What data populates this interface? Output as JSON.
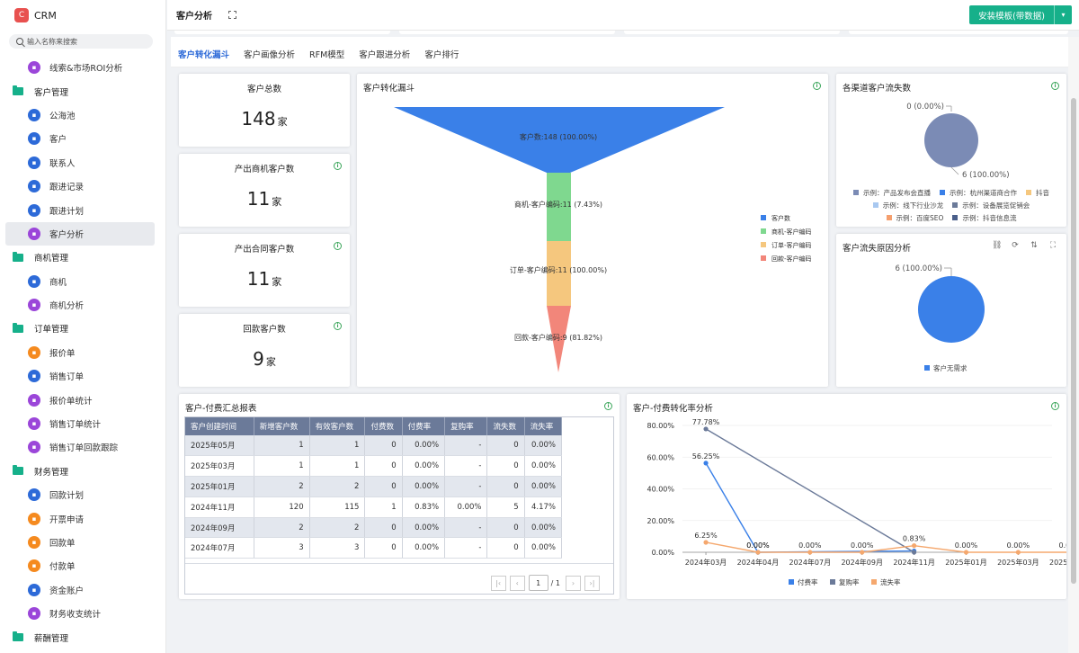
{
  "app": {
    "logo_letter": "C",
    "name": "CRM",
    "search_placeholder": "输入名称来搜索"
  },
  "nav": [
    {
      "type": "item",
      "label": "线索&市场ROI分析",
      "icon": "chart-board-icon",
      "color": "purple"
    },
    {
      "type": "group",
      "label": "客户管理"
    },
    {
      "type": "item",
      "label": "公海池",
      "icon": "user-pool-icon",
      "color": "blue"
    },
    {
      "type": "item",
      "label": "客户",
      "icon": "customer-icon",
      "color": "blue"
    },
    {
      "type": "item",
      "label": "联系人",
      "icon": "contact-icon",
      "color": "blue"
    },
    {
      "type": "item",
      "label": "跟进记录",
      "icon": "record-icon",
      "color": "blue"
    },
    {
      "type": "item",
      "label": "跟进计划",
      "icon": "plan-icon",
      "color": "blue"
    },
    {
      "type": "item",
      "label": "客户分析",
      "icon": "chart-board-icon",
      "color": "purple",
      "active": true
    },
    {
      "type": "group",
      "label": "商机管理"
    },
    {
      "type": "item",
      "label": "商机",
      "icon": "opportunity-icon",
      "color": "blue"
    },
    {
      "type": "item",
      "label": "商机分析",
      "icon": "chart-board-icon",
      "color": "purple"
    },
    {
      "type": "group",
      "label": "订单管理"
    },
    {
      "type": "item",
      "label": "报价单",
      "icon": "send-icon",
      "color": "orange"
    },
    {
      "type": "item",
      "label": "销售订单",
      "icon": "order-icon",
      "color": "blue"
    },
    {
      "type": "item",
      "label": "报价单统计",
      "icon": "chart-board-icon",
      "color": "purple"
    },
    {
      "type": "item",
      "label": "销售订单统计",
      "icon": "chart-board-icon",
      "color": "purple"
    },
    {
      "type": "item",
      "label": "销售订单回款跟踪",
      "icon": "chart-board-icon",
      "color": "purple"
    },
    {
      "type": "group",
      "label": "财务管理"
    },
    {
      "type": "item",
      "label": "回款计划",
      "icon": "plan-icon",
      "color": "blue"
    },
    {
      "type": "item",
      "label": "开票申请",
      "icon": "invoice-icon",
      "color": "orange"
    },
    {
      "type": "item",
      "label": "回款单",
      "icon": "receipt-icon",
      "color": "orange"
    },
    {
      "type": "item",
      "label": "付款单",
      "icon": "payment-icon",
      "color": "orange"
    },
    {
      "type": "item",
      "label": "资金账户",
      "icon": "account-icon",
      "color": "blue"
    },
    {
      "type": "item",
      "label": "财务收支统计",
      "icon": "chart-board-icon",
      "color": "purple"
    },
    {
      "type": "group",
      "label": "薪酬管理"
    }
  ],
  "topbar": {
    "title": "客户分析",
    "install_label": "安装模板(带数据)"
  },
  "tabs": [
    "客户转化漏斗",
    "客户画像分析",
    "RFM模型",
    "客户跟进分析",
    "客户排行"
  ],
  "stats": [
    {
      "label": "客户总数",
      "value": "148",
      "unit": "家",
      "info": false
    },
    {
      "label": "产出商机客户数",
      "value": "11",
      "unit": "家",
      "info": true
    },
    {
      "label": "产出合同客户数",
      "value": "11",
      "unit": "家",
      "info": true
    },
    {
      "label": "回款客户数",
      "value": "9",
      "unit": "家",
      "info": true
    }
  ],
  "funnel": {
    "title": "客户转化漏斗",
    "stages": [
      {
        "label": "客户数:148 (100.00%)",
        "legend": "客户数",
        "value": 148,
        "color": "#3a80e8"
      },
      {
        "label": "商机-客户编码:11 (7.43%)",
        "legend": "商机-客户编码",
        "value": 11,
        "color": "#7fd88f"
      },
      {
        "label": "订单-客户编码:11 (100.00%)",
        "legend": "订单-客户编码",
        "value": 11,
        "color": "#f5c77e"
      },
      {
        "label": "回款-客户编码:9 (81.82%)",
        "legend": "回款-客户编码",
        "value": 9,
        "color": "#f2867a"
      }
    ]
  },
  "churn_channel": {
    "title": "各渠道客户流失数",
    "pie_labels": {
      "top": "0 (0.00%)",
      "bottom": "6 (100.00%)"
    },
    "legend": [
      {
        "label": "示例：产品发布会直播",
        "color": "#7b8bb5"
      },
      {
        "label": "示例：杭州渠道商合作",
        "color": "#3a80e8"
      },
      {
        "label": "抖音",
        "color": "#f5c77e"
      },
      {
        "label": "示例：线下行业沙龙",
        "color": "#a8c8f0"
      },
      {
        "label": "示例：设备展览促销会",
        "color": "#6b7a99"
      },
      {
        "label": "示例：百度SEO",
        "color": "#f59f6e"
      },
      {
        "label": "示例：抖音信息流",
        "color": "#4a5f8a"
      }
    ],
    "slice_color": "#7b8bb5"
  },
  "churn_reason": {
    "title": "客户流失原因分析",
    "pie_label": "6 (100.00%)",
    "legend": [
      {
        "label": "客户无需求",
        "color": "#3a80e8"
      }
    ],
    "tools": [
      "link-icon",
      "refresh-icon",
      "sort-icon",
      "fullscreen-icon"
    ]
  },
  "pay_table": {
    "title": "客户-付费汇总报表",
    "headers": [
      "客户创建时间",
      "新增客户数",
      "有效客户数",
      "付费数",
      "付费率",
      "复购率",
      "流失数",
      "流失率"
    ],
    "rows": [
      [
        "2025年05月",
        "1",
        "1",
        "0",
        "0.00%",
        "-",
        "0",
        "0.00%"
      ],
      [
        "2025年03月",
        "1",
        "1",
        "0",
        "0.00%",
        "-",
        "0",
        "0.00%"
      ],
      [
        "2025年01月",
        "2",
        "2",
        "0",
        "0.00%",
        "-",
        "0",
        "0.00%"
      ],
      [
        "2024年11月",
        "120",
        "115",
        "1",
        "0.83%",
        "0.00%",
        "5",
        "4.17%"
      ],
      [
        "2024年09月",
        "2",
        "2",
        "0",
        "0.00%",
        "-",
        "0",
        "0.00%"
      ],
      [
        "2024年07月",
        "3",
        "3",
        "0",
        "0.00%",
        "-",
        "0",
        "0.00%"
      ]
    ],
    "pager": {
      "page": "1",
      "total": "/ 1"
    }
  },
  "chart_data": {
    "type": "line",
    "title": "客户-付费转化率分析",
    "categories": [
      "2024年03月",
      "2024年04月",
      "2024年07月",
      "2024年09月",
      "2024年11月",
      "2025年01月",
      "2025年03月",
      "2025年05月"
    ],
    "ylim": [
      0,
      80
    ],
    "yticks": [
      "0.00%",
      "20.00%",
      "40.00%",
      "60.00%",
      "80.00%"
    ],
    "series": [
      {
        "name": "付费率",
        "color": "#3a80e8",
        "values": [
          56.25,
          0,
          null,
          null,
          0.83,
          null,
          null,
          null
        ],
        "labels": [
          "56.25%",
          "0.00%",
          "",
          "",
          "",
          "",
          "",
          ""
        ]
      },
      {
        "name": "复购率",
        "color": "#6b7a99",
        "values": [
          77.78,
          null,
          null,
          null,
          0,
          null,
          null,
          null
        ],
        "labels": [
          "77.78%",
          "",
          "",
          "",
          "",
          "",
          "",
          ""
        ]
      },
      {
        "name": "流失率",
        "color": "#f5a86e",
        "values": [
          6.25,
          0,
          0,
          0,
          4.17,
          0,
          0,
          0
        ],
        "labels": [
          "6.25%",
          "0.00%",
          "0.00%",
          "0.00%",
          "0.83%",
          "0.00%",
          "0.00%",
          "0.00%"
        ]
      }
    ]
  }
}
